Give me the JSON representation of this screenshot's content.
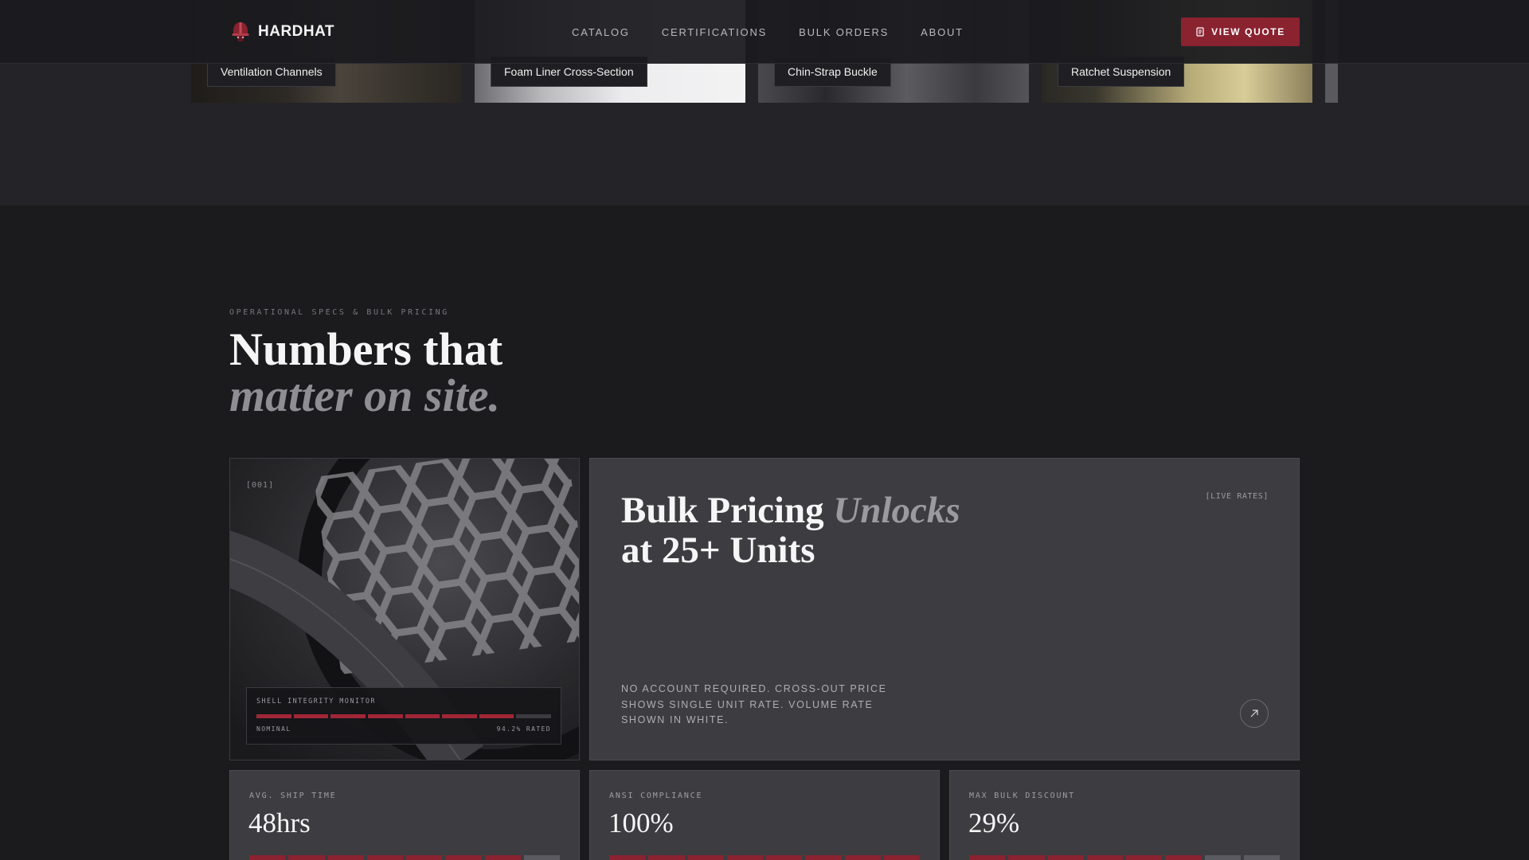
{
  "brand": {
    "name": "HARDHAT"
  },
  "nav": {
    "items": [
      "CATALOG",
      "CERTIFICATIONS",
      "BULK ORDERS",
      "ABOUT"
    ]
  },
  "header": {
    "cta_label": "VIEW QUOTE"
  },
  "gallery": {
    "captions": [
      "Ventilation Channels",
      "Foam Liner Cross-Section",
      "Chin-Strap Buckle",
      "Ratchet Suspension"
    ]
  },
  "specs": {
    "eyebrow": "OPERATIONAL SPECS & BULK PRICING",
    "headline_line1": "Numbers that",
    "headline_line2": "matter on site.",
    "image_card": {
      "tag": "[001]",
      "monitor_title": "SHELL INTEGRITY MONITOR",
      "monitor_status": "NOMINAL",
      "monitor_rating": "94.2% RATED",
      "monitor_segments_on": 7,
      "monitor_segments_total": 8
    },
    "pricing": {
      "title_a": "Bulk Pricing",
      "title_b": "Unlocks",
      "title_c": "at 25+ Units",
      "live_tag": "[LIVE RATES]",
      "description": "NO ACCOUNT REQUIRED. CROSS-OUT PRICE SHOWS SINGLE UNIT RATE. VOLUME RATE SHOWN IN WHITE."
    },
    "stats": [
      {
        "label": "AVG. SHIP TIME",
        "value": "48hrs",
        "segments_on": 7,
        "segments_total": 8
      },
      {
        "label": "ANSI COMPLIANCE",
        "value": "100%",
        "segments_on": 8,
        "segments_total": 8
      },
      {
        "label": "MAX BULK DISCOUNT",
        "value": "29%",
        "segments_on": 6,
        "segments_total": 8
      }
    ]
  },
  "colors": {
    "accent": "#8a2230",
    "background": "#1b1b1e",
    "card": "#3c3c41"
  },
  "icons": {
    "brand": "helmet-icon",
    "cta": "document-icon",
    "arrow": "arrow-up-right-icon"
  }
}
